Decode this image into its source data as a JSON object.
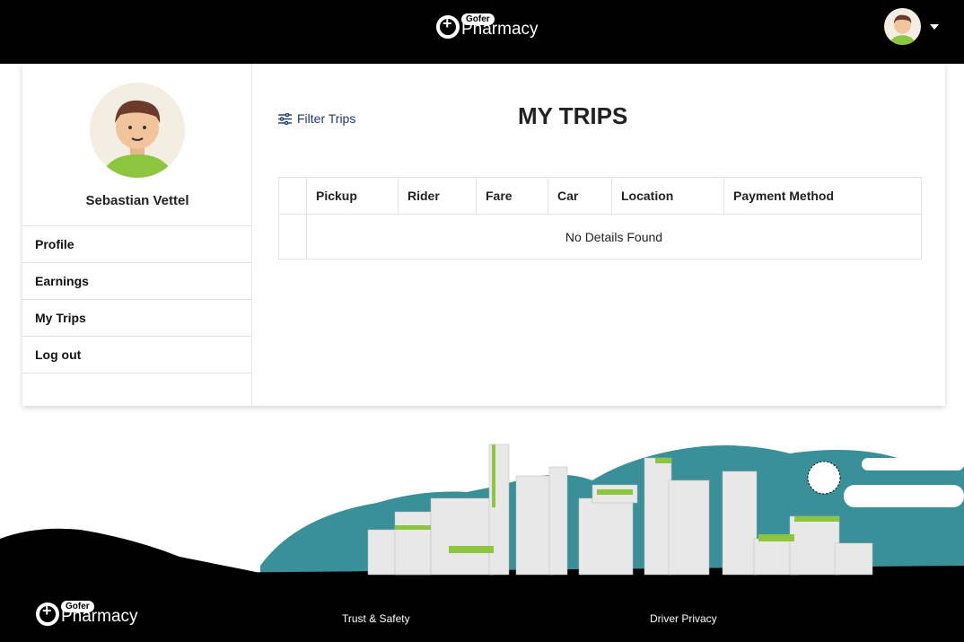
{
  "header": {
    "brand_badge": "Gofer",
    "brand_name": "Pharmacy"
  },
  "sidebar": {
    "user_name": "Sebastian Vettel",
    "items": [
      {
        "label": "Profile"
      },
      {
        "label": "Earnings"
      },
      {
        "label": "My Trips"
      },
      {
        "label": "Log out"
      }
    ]
  },
  "main": {
    "filter_label": "Filter Trips",
    "title": "MY TRIPS",
    "columns": [
      "",
      "Pickup",
      "Rider",
      "Fare",
      "Car",
      "Location",
      "Payment Method"
    ],
    "empty_text": "No Details Found"
  },
  "footer": {
    "brand_badge": "Gofer",
    "brand_name": "Pharmacy",
    "links": [
      "Trust & Safety",
      "Driver Privacy"
    ]
  },
  "colors": {
    "header": "#000000",
    "accent_teal": "#3a9098",
    "accent_green": "#8cc63f",
    "link": "#1a3a6e"
  }
}
